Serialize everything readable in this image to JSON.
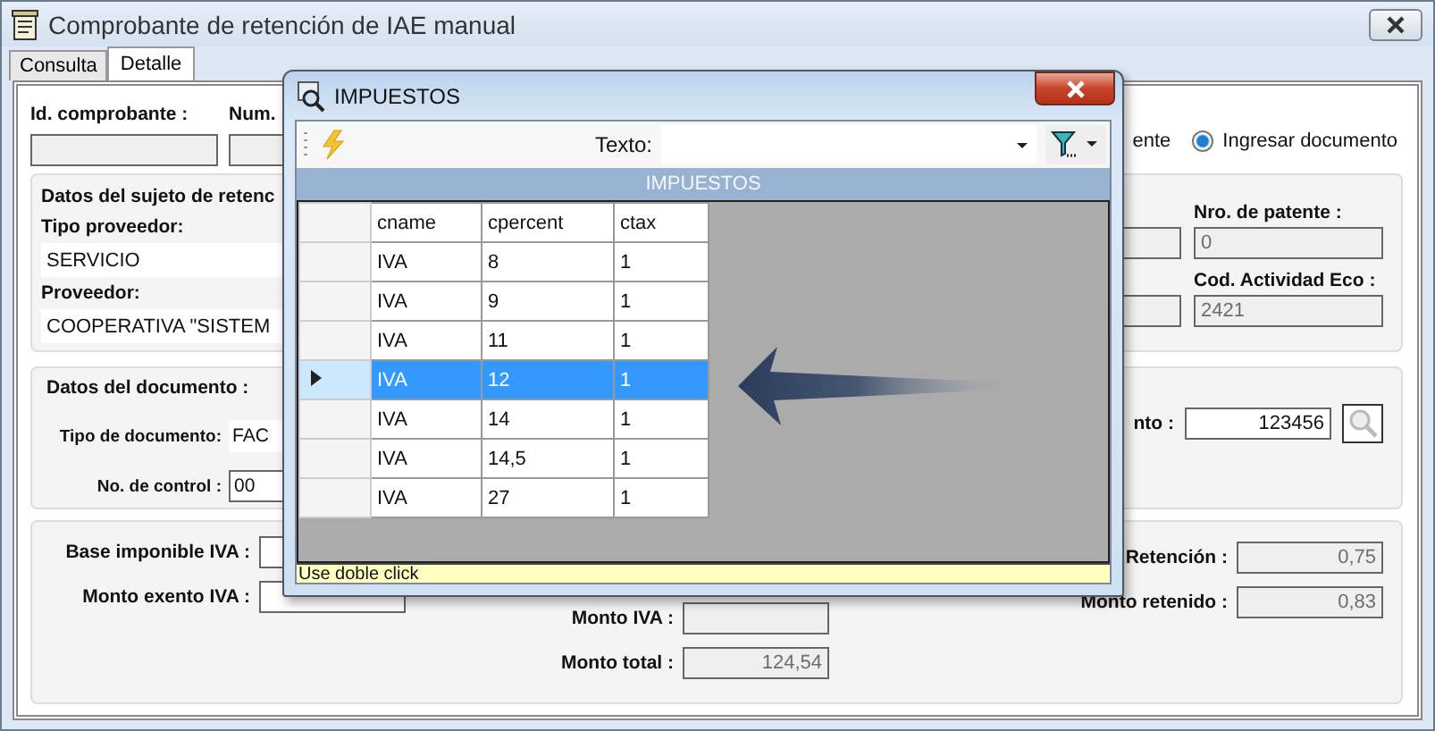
{
  "window": {
    "title": "Comprobante de retención de IAE manual"
  },
  "tabs": [
    {
      "label": "Consulta",
      "selected": false
    },
    {
      "label": "Detalle",
      "selected": true
    }
  ],
  "header": {
    "id_label": "Id. comprobante :",
    "num_label": "Num."
  },
  "partial_radio_label": "ente",
  "mode_radio": {
    "label": "Ingresar documento",
    "selected": true
  },
  "supplier_group": {
    "title": "Datos del sujeto de retenc",
    "left_fields": [
      {
        "label": "Tipo proveedor:",
        "value": "SERVICIO"
      },
      {
        "label": "Proveedor:",
        "value": "COOPERATIVA \"SISTEM"
      }
    ],
    "right_fields": [
      {
        "label": "Nro. de patente :",
        "value": "0"
      },
      {
        "label": "Cod. Actividad Eco :",
        "value": "2421"
      }
    ]
  },
  "document_group": {
    "title": "Datos del documento :",
    "type_label": "Tipo de documento:",
    "type_value": "FAC",
    "control_label": "No. de control :",
    "control_value": "00",
    "number_label": "nto :",
    "number_value": "123456"
  },
  "amounts": {
    "left": [
      {
        "label": "Base imponible IVA :"
      },
      {
        "label": "Monto exento IVA :"
      }
    ],
    "middle": [
      {
        "label": "Monto IVA :"
      },
      {
        "label": "Monto total :",
        "value": "124,54"
      }
    ],
    "right": [
      {
        "label": "Retención :",
        "value": "0,75"
      },
      {
        "label": "Monto retenido :",
        "value": "0,83"
      }
    ]
  },
  "dialog": {
    "title": "IMPUESTOS",
    "search_label": "Texto:",
    "grid_title": "IMPUESTOS",
    "columns": [
      "cname",
      "cpercent",
      "ctax"
    ],
    "rows": [
      {
        "cells": [
          "IVA",
          "8",
          "1"
        ],
        "selected": false
      },
      {
        "cells": [
          "IVA",
          "9",
          "1"
        ],
        "selected": false
      },
      {
        "cells": [
          "IVA",
          "11",
          "1"
        ],
        "selected": false
      },
      {
        "cells": [
          "IVA",
          "12",
          "1"
        ],
        "selected": true
      },
      {
        "cells": [
          "IVA",
          "14",
          "1"
        ],
        "selected": false
      },
      {
        "cells": [
          "IVA",
          "14,5",
          "1"
        ],
        "selected": false
      },
      {
        "cells": [
          "IVA",
          "27",
          "1"
        ],
        "selected": false
      }
    ],
    "status": "Use doble click"
  }
}
